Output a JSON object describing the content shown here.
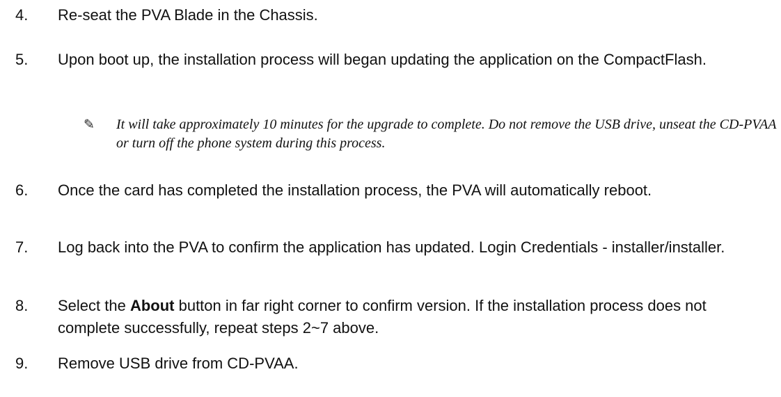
{
  "steps": [
    {
      "number": "4.",
      "text": "Re-seat the PVA Blade in the Chassis."
    },
    {
      "number": "5.",
      "text": "Upon boot up, the installation process will began updating the application on the CompactFlash."
    },
    {
      "number": "6.",
      "text": "Once the card has completed the installation process, the PVA will automatically reboot."
    },
    {
      "number": "7.",
      "text": "Log back into the PVA to confirm the application has updated. Login Credentials - installer/installer."
    },
    {
      "number": "8.",
      "text_before": "Select the ",
      "bold": "About",
      "text_after": " button in far right corner to confirm version. If the installation process does not complete successfully, repeat steps 2~7 above."
    },
    {
      "number": "9.",
      "text": "Remove USB drive from CD-PVAA."
    }
  ],
  "note": {
    "icon": "pencil-icon",
    "icon_glyph": "✎",
    "text": "It will take approximately 10 minutes for the upgrade to complete. Do not remove the USB drive, unseat the CD-PVAA or turn off the phone system during this process."
  }
}
